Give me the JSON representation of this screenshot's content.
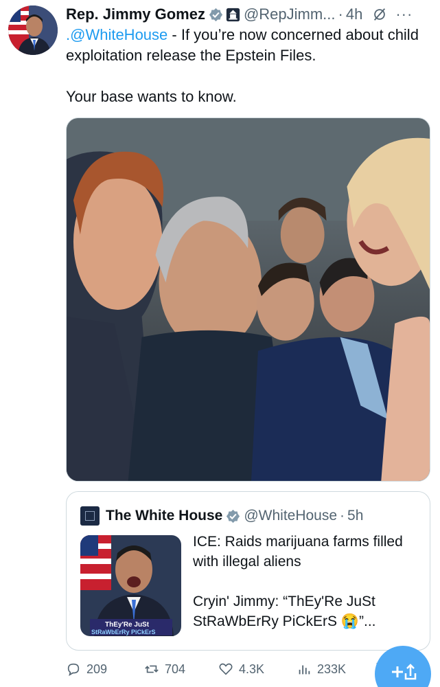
{
  "author": {
    "name": "Rep. Jimmy Gomez",
    "handle": "@RepJimm...",
    "separator": "·",
    "time": "4h",
    "more": "···"
  },
  "tweet": {
    "mention": ".@WhiteHouse",
    "text_line1": " - If you’re now concerned about child exploitation release the Epstein Files.",
    "text_line2": "Your base wants to know."
  },
  "quote": {
    "name": "The White House",
    "handle": "@WhiteHouse",
    "separator": "·",
    "time": "5h",
    "text1": "ICE: Raids marijuana farms filled with illegal aliens",
    "text2": "Cryin' Jimmy: “ThEy'Re JuSt StRaWbErRy PiCkErS 😭”...",
    "thumb_caption_line1": "ThEy'Re JuSt",
    "thumb_caption_line2": "StRaWbErRy PiCkErS"
  },
  "actions": {
    "replies": "209",
    "reposts": "704",
    "likes": "4.3K",
    "views": "233K"
  },
  "colors": {
    "accent": "#1d9bf0",
    "muted": "#536471",
    "fab": "#4ea9f5"
  },
  "icons": [
    "verified-badge-icon",
    "government-badge-icon",
    "grok-icon",
    "more-icon",
    "reply-icon",
    "repost-icon",
    "like-icon",
    "views-icon",
    "bookmark-icon",
    "share-icon",
    "compose-icon"
  ]
}
